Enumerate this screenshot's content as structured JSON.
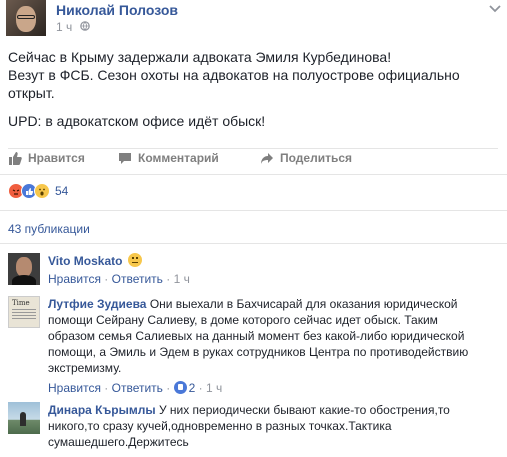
{
  "post": {
    "author": "Николай Полозов",
    "time": "1 ч",
    "paragraph1_line1": "Сейчас в Крыму задержали адвоката Эмиля Курбединова!",
    "paragraph1_line2": "Везут в ФСБ. Сезон охоты на адвокатов на полуострове официально",
    "paragraph1_line3": "открыт.",
    "paragraph2": "UPD: в адвокатском офисе идёт обыск!"
  },
  "actions": {
    "like": "Нравится",
    "comment": "Комментарий",
    "share": "Поделиться"
  },
  "reactions": {
    "count": "54",
    "icons": [
      "angry-icon",
      "like-icon",
      "wow-icon"
    ]
  },
  "shares": "43 публикации",
  "comments": [
    {
      "name": "Vito Moskato",
      "text": "",
      "like": "Нравится",
      "sep1": " · ",
      "reply": "Ответить",
      "sep2": " · ",
      "time": "1 ч"
    },
    {
      "name": "Лутфие Зудиева",
      "text_line1": "Они выехали в Бахчисарай для оказания юридической",
      "text_line2": "помощи Сейрану Салиеву, в доме которого сейчас идет обыск. Таким",
      "text_line3": "образом семья Салиевых на данный момент без какой-либо юридической",
      "text_line4": "помощи, а Эмиль и Эдем в руках сотрудников Центра по противодействию",
      "text_line5": "экстремизму.",
      "like": "Нравится",
      "sep1": " · ",
      "reply": "Ответить",
      "sep2": " · ",
      "likes": "2",
      "sep3": " · ",
      "time": "1 ч"
    },
    {
      "name": "Динара Кърымлы",
      "text_line1": "У них периодически бывают какие-то обострения,то",
      "text_line2": "никого,то сразу кучей,одновременно в разных точках.Тактика",
      "text_line3": "сумашедшего.Держитесь"
    }
  ],
  "colors": {
    "link": "#365899",
    "meta": "#90949c",
    "text": "#1d2129"
  }
}
